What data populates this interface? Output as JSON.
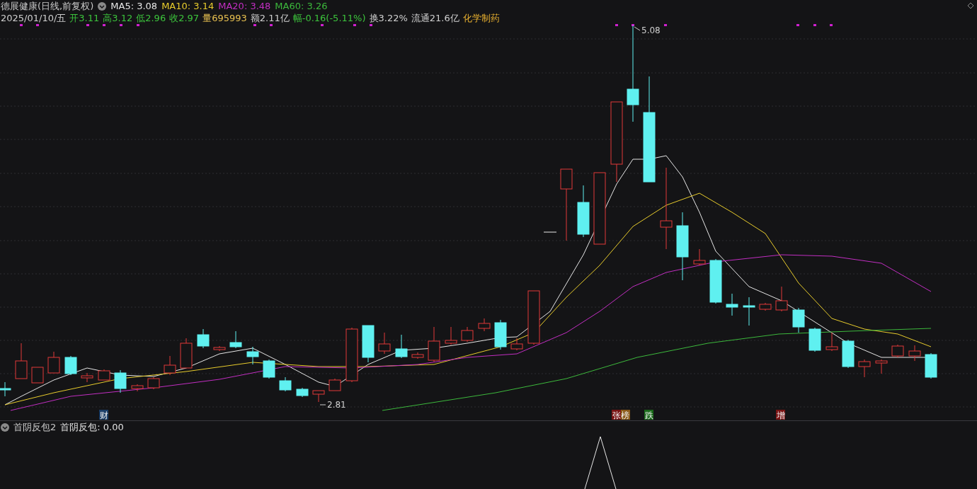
{
  "header": {
    "title": "德展健康(日线,前复权)",
    "ma": [
      {
        "label": "MA5: 3.08",
        "color": "#e6e6e6"
      },
      {
        "label": "MA10: 3.14",
        "color": "#e8cc2c"
      },
      {
        "label": "MA20: 3.48",
        "color": "#c22ec2"
      },
      {
        "label": "MA60: 3.26",
        "color": "#3cb83c"
      }
    ]
  },
  "quote": [
    {
      "text": "2025/01/10/五",
      "color": "#d0d0d0"
    },
    {
      "text": "开3.11",
      "color": "#3cc43c"
    },
    {
      "text": "高3.12",
      "color": "#3cc43c"
    },
    {
      "text": "低2.96",
      "color": "#3cc43c"
    },
    {
      "text": "收2.97",
      "color": "#3cc43c"
    },
    {
      "text": "量695993",
      "color": "#e8c050"
    },
    {
      "text": "额2.11亿",
      "color": "#d0d0d0"
    },
    {
      "text": "幅-0.16(-5.11%)",
      "color": "#3cc43c"
    },
    {
      "text": "换3.22%",
      "color": "#d0d0d0"
    },
    {
      "text": "流通21.6亿",
      "color": "#d0d0d0"
    },
    {
      "text": "化学制药",
      "color": "#e8b030"
    }
  ],
  "price_labels": [
    {
      "text": "5.08"
    },
    {
      "text": "2.81"
    }
  ],
  "event_tags": [
    {
      "parts": [
        {
          "text": "财",
          "color": "#1a3d66"
        }
      ]
    },
    {
      "parts": [
        {
          "text": "张",
          "color": "#7a1414"
        },
        {
          "text": "榜",
          "color": "#8a5a18"
        }
      ]
    },
    {
      "parts": [
        {
          "text": "跌",
          "color": "#1a6a1a"
        }
      ]
    },
    {
      "parts": [
        {
          "text": "增",
          "color": "#7a1414"
        }
      ]
    }
  ],
  "indicator": {
    "name": "首阴反包2",
    "value": "首阴反包: 0.00"
  }
}
